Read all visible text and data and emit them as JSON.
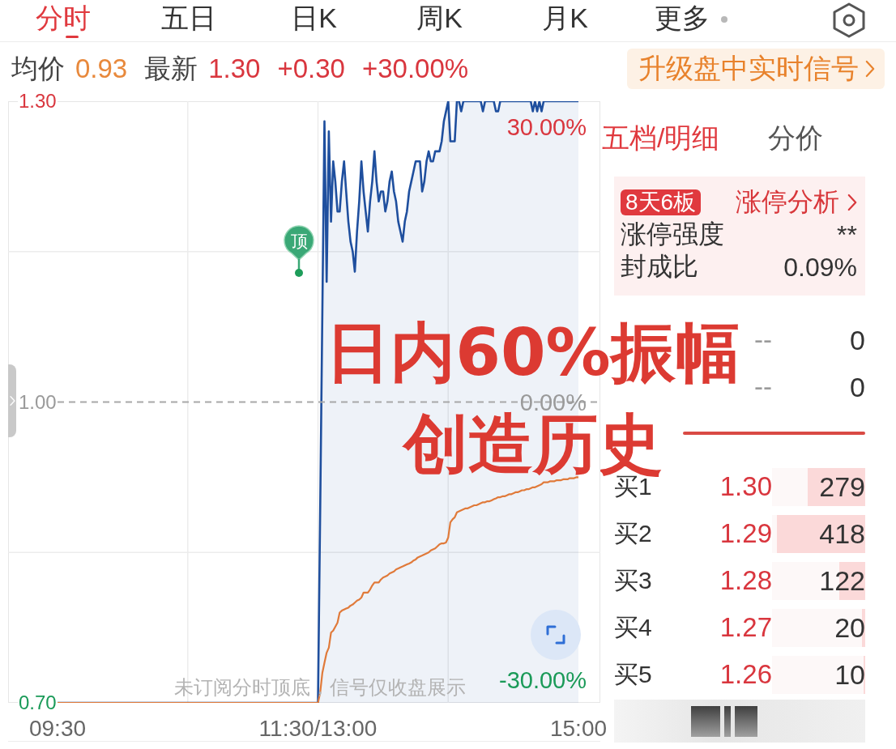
{
  "tabs": [
    {
      "label": "分时",
      "selected": true,
      "kind": "tab"
    },
    {
      "label": "五日",
      "selected": false,
      "kind": "tab"
    },
    {
      "label": "日K",
      "selected": false,
      "kind": "tab"
    },
    {
      "label": "周K",
      "selected": false,
      "kind": "tab"
    },
    {
      "label": "月K",
      "selected": false,
      "kind": "tab"
    },
    {
      "label": "更多",
      "selected": false,
      "kind": "menu"
    }
  ],
  "quote_bar": {
    "fields": [
      {
        "label": "均价",
        "value": "0.93",
        "kind": "average"
      },
      {
        "label": "最新",
        "value": "1.30",
        "kind": "latest"
      },
      {
        "value": "+0.30",
        "kind": "change"
      },
      {
        "value": "+30.00%",
        "kind": "change"
      }
    ],
    "signal_button": "升级盘中实时信号"
  },
  "chart": {
    "chart_data": {
      "type": "area",
      "categories": [
        "09:30",
        null,
        null,
        null,
        null,
        null,
        null,
        null,
        null,
        null,
        null,
        null,
        null,
        null,
        null,
        null,
        null,
        null,
        null,
        null,
        null,
        null,
        null,
        null,
        null,
        null,
        null,
        null,
        null,
        null,
        null,
        null,
        null,
        null,
        null,
        null,
        null,
        null,
        null,
        null,
        null,
        null,
        null,
        null,
        null,
        null,
        null,
        null,
        null,
        null,
        null,
        null,
        null,
        null,
        null,
        null,
        null,
        null,
        null,
        null,
        null,
        null,
        null,
        null,
        null,
        null,
        null,
        null,
        null,
        null,
        null,
        null,
        null,
        null,
        null,
        null,
        null,
        null,
        null,
        null,
        null,
        null,
        null,
        null,
        null,
        null,
        null,
        null,
        null,
        null,
        null,
        null,
        null,
        null,
        null,
        null,
        null,
        null,
        null,
        null,
        null,
        null,
        null,
        null,
        null,
        null,
        null,
        null,
        null,
        null,
        null,
        null,
        null,
        null,
        null,
        null,
        null,
        null,
        null,
        null,
        "11:30/13:00",
        null,
        null,
        null,
        null,
        null,
        null,
        null,
        null,
        null,
        null,
        null,
        null,
        null,
        null,
        null,
        null,
        null,
        null,
        null,
        null,
        null,
        null,
        null,
        null,
        null,
        null,
        null,
        null,
        null,
        null,
        null,
        null,
        null,
        null,
        null,
        null,
        null,
        null,
        null,
        null,
        null,
        null,
        null,
        null,
        null,
        null,
        null,
        null,
        null,
        null,
        null,
        null,
        null,
        null,
        null,
        null,
        null,
        null,
        null,
        null,
        null,
        null,
        null,
        null,
        null,
        null,
        null,
        null,
        null,
        null,
        null,
        null,
        null,
        null,
        null,
        null,
        null,
        null,
        null,
        null,
        null,
        null,
        null,
        null,
        null,
        null,
        null,
        null,
        null,
        null,
        null,
        null,
        null,
        null,
        null,
        null,
        null,
        null,
        null,
        null,
        null,
        null,
        null,
        null,
        null,
        null,
        null,
        null,
        null,
        null,
        null,
        null,
        null,
        null,
        null,
        null,
        null,
        null,
        null,
        "15:00"
      ],
      "series": [
        {
          "color": "#1f4f9e",
          "values": [
            0.7,
            0.7,
            0.7,
            0.7,
            0.7,
            0.7,
            0.7,
            0.7,
            0.7,
            0.7,
            0.7,
            0.7,
            0.7,
            0.7,
            0.7,
            0.7,
            0.7,
            0.7,
            0.7,
            0.7,
            0.7,
            0.7,
            0.7,
            0.7,
            0.7,
            0.7,
            0.7,
            0.7,
            0.7,
            0.7,
            0.7,
            0.7,
            0.7,
            0.7,
            0.7,
            0.7,
            0.7,
            0.7,
            0.7,
            0.7,
            0.7,
            0.7,
            0.7,
            0.7,
            0.7,
            0.7,
            0.7,
            0.7,
            0.7,
            0.7,
            0.7,
            0.7,
            0.7,
            0.7,
            0.7,
            0.7,
            0.7,
            0.7,
            0.7,
            0.7,
            0.7,
            0.7,
            0.7,
            0.7,
            0.7,
            0.7,
            0.7,
            0.7,
            0.7,
            0.7,
            0.7,
            0.7,
            0.7,
            0.7,
            0.7,
            0.7,
            0.7,
            0.7,
            0.7,
            0.7,
            0.7,
            0.7,
            0.7,
            0.7,
            0.7,
            0.7,
            0.7,
            0.7,
            0.7,
            0.7,
            0.7,
            0.7,
            0.7,
            0.7,
            0.7,
            0.7,
            0.7,
            0.7,
            0.7,
            0.7,
            0.7,
            0.7,
            0.7,
            0.7,
            0.7,
            0.7,
            0.7,
            0.7,
            0.7,
            0.7,
            0.7,
            0.7,
            0.7,
            0.7,
            0.7,
            0.7,
            0.7,
            0.7,
            0.7,
            0.7,
            0.7,
            0.89,
            1.09,
            1.28,
            1.12,
            1.27,
            1.18,
            1.24,
            1.22,
            1.19,
            1.19,
            1.22,
            1.24,
            1.21,
            1.18,
            1.16,
            1.15,
            1.13,
            1.17,
            1.2,
            1.24,
            1.21,
            1.19,
            1.17,
            1.2,
            1.22,
            1.25,
            1.22,
            1.2,
            1.21,
            1.21,
            1.19,
            1.2,
            1.22,
            1.23,
            1.21,
            1.2,
            1.18,
            1.17,
            1.16,
            1.18,
            1.19,
            1.21,
            1.22,
            1.23,
            1.24,
            1.24,
            1.24,
            1.21,
            1.22,
            1.24,
            1.25,
            1.24,
            1.24,
            1.25,
            1.25,
            1.25,
            1.26,
            1.28,
            1.29,
            1.3,
            1.26,
            1.26,
            1.26,
            1.3,
            1.3,
            1.29,
            1.3,
            1.3,
            1.3,
            1.3,
            1.3,
            1.3,
            1.3,
            1.3,
            1.3,
            1.29,
            1.3,
            1.3,
            1.3,
            1.3,
            1.3,
            1.29,
            1.29,
            1.3,
            1.3,
            1.3,
            1.3,
            1.3,
            1.3,
            1.3,
            1.3,
            1.3,
            1.3,
            1.3,
            1.3,
            1.3,
            1.3,
            1.3,
            1.29,
            1.3,
            1.29,
            1.3,
            1.29,
            1.3,
            1.3,
            1.3,
            1.3,
            1.3,
            1.3,
            1.3,
            1.3,
            1.3,
            1.3,
            1.3,
            1.3,
            1.3,
            1.3,
            1.3,
            1.3,
            1.3
          ]
        },
        {
          "color": "#e07a3a",
          "type": "line",
          "values": [
            0.7,
            0.7,
            0.7,
            0.7,
            0.7,
            0.7,
            0.7,
            0.7,
            0.7,
            0.7,
            0.7,
            0.7,
            0.7,
            0.7,
            0.7,
            0.7,
            0.7,
            0.7,
            0.7,
            0.7,
            0.7,
            0.7,
            0.7,
            0.7,
            0.7,
            0.7,
            0.7,
            0.7,
            0.7,
            0.7,
            0.7,
            0.7,
            0.7,
            0.7,
            0.7,
            0.7,
            0.7,
            0.7,
            0.7,
            0.7,
            0.7,
            0.7,
            0.7,
            0.7,
            0.7,
            0.7,
            0.7,
            0.7,
            0.7,
            0.7,
            0.7,
            0.7,
            0.7,
            0.7,
            0.7,
            0.7,
            0.7,
            0.7,
            0.7,
            0.7,
            0.7,
            0.7,
            0.7,
            0.7,
            0.7,
            0.7,
            0.7,
            0.7,
            0.7,
            0.7,
            0.7,
            0.7,
            0.7,
            0.7,
            0.7,
            0.7,
            0.7,
            0.7,
            0.7,
            0.7,
            0.7,
            0.7,
            0.7,
            0.7,
            0.7,
            0.7,
            0.7,
            0.7,
            0.7,
            0.7,
            0.7,
            0.7,
            0.7,
            0.7,
            0.7,
            0.7,
            0.7,
            0.7,
            0.7,
            0.7,
            0.7,
            0.7,
            0.7,
            0.7,
            0.7,
            0.7,
            0.7,
            0.7,
            0.7,
            0.7,
            0.7,
            0.7,
            0.7,
            0.7,
            0.7,
            0.7,
            0.7,
            0.7,
            0.7,
            0.7,
            0.7,
            0.71,
            0.73,
            0.74,
            0.75,
            0.755,
            0.77,
            0.772,
            0.776,
            0.78,
            0.79,
            0.792,
            0.793,
            0.794,
            0.795,
            0.797,
            0.798,
            0.8,
            0.802,
            0.803,
            0.805,
            0.81,
            0.81,
            0.81,
            0.813,
            0.817,
            0.82,
            0.82,
            0.82,
            0.823,
            0.825,
            0.826,
            0.827,
            0.829,
            0.83,
            0.831,
            0.833,
            0.834,
            0.835,
            0.836,
            0.837,
            0.838,
            0.839,
            0.84,
            0.842,
            0.843,
            0.845,
            0.846,
            0.847,
            0.848,
            0.849,
            0.85,
            0.852,
            0.853,
            0.854,
            0.856,
            0.858,
            0.859,
            0.859,
            0.86,
            0.865,
            0.88,
            0.883,
            0.885,
            0.89,
            0.891,
            0.892,
            0.893,
            0.894,
            0.894,
            0.895,
            0.896,
            0.897,
            0.897,
            0.898,
            0.899,
            0.9,
            0.9,
            0.901,
            0.901,
            0.902,
            0.903,
            0.904,
            0.905,
            0.905,
            0.906,
            0.906,
            0.907,
            0.908,
            0.908,
            0.909,
            0.91,
            0.91,
            0.911,
            0.912,
            0.912,
            0.913,
            0.913,
            0.914,
            0.915,
            0.915,
            0.916,
            0.917,
            0.918,
            0.92,
            0.92,
            0.92,
            0.921,
            0.921,
            0.921,
            0.922,
            0.922,
            0.922,
            0.923,
            0.923,
            0.923,
            0.924,
            0.924,
            0.924,
            0.925,
            0.925
          ]
        }
      ],
      "ylim": [
        0.7,
        1.3
      ],
      "yticks": [
        {
          "value": 1.3,
          "label": "1.30"
        },
        {
          "value": 1.0,
          "label": "1.00"
        },
        {
          "value": 0.7,
          "label": "0.70"
        }
      ],
      "ref_lines": [
        {
          "axis": "y",
          "value": 1.0
        }
      ],
      "annotations": [
        "顶"
      ]
    },
    "right_axis": [
      "30.00%",
      "0.00%",
      "-30.00%"
    ],
    "notice": "未订阅分时顶底，信号仅收盘展示"
  },
  "caption": [
    "日内60%振幅",
    "创造历史"
  ],
  "order_book": {
    "tabs": [
      {
        "label": "五档/明细",
        "selected": true
      },
      {
        "label": "分价",
        "selected": false
      }
    ],
    "limit_up_card": {
      "badge": "8天6板",
      "link": "涨停分析",
      "stats": [
        {
          "label": "涨停强度",
          "value": "**"
        },
        {
          "label": "封成比",
          "value": "0.09%"
        }
      ]
    },
    "asks": [
      {
        "price": "--",
        "volume": "0",
        "empty": true
      },
      {
        "price": "--",
        "volume": "0",
        "empty": true
      }
    ],
    "bids": [
      {
        "label": "买1",
        "price": "1.30",
        "volume": "279",
        "empty": false,
        "level": 0.62
      },
      {
        "label": "买2",
        "price": "1.29",
        "volume": "418",
        "empty": false,
        "level": 0.95
      },
      {
        "label": "买3",
        "price": "1.28",
        "volume": "122",
        "empty": false,
        "level": 0.28
      },
      {
        "label": "买4",
        "price": "1.27",
        "volume": "20",
        "empty": false,
        "level": 0.035
      },
      {
        "label": "买5",
        "price": "1.26",
        "volume": "10",
        "empty": false,
        "level": 0.02
      }
    ]
  }
}
